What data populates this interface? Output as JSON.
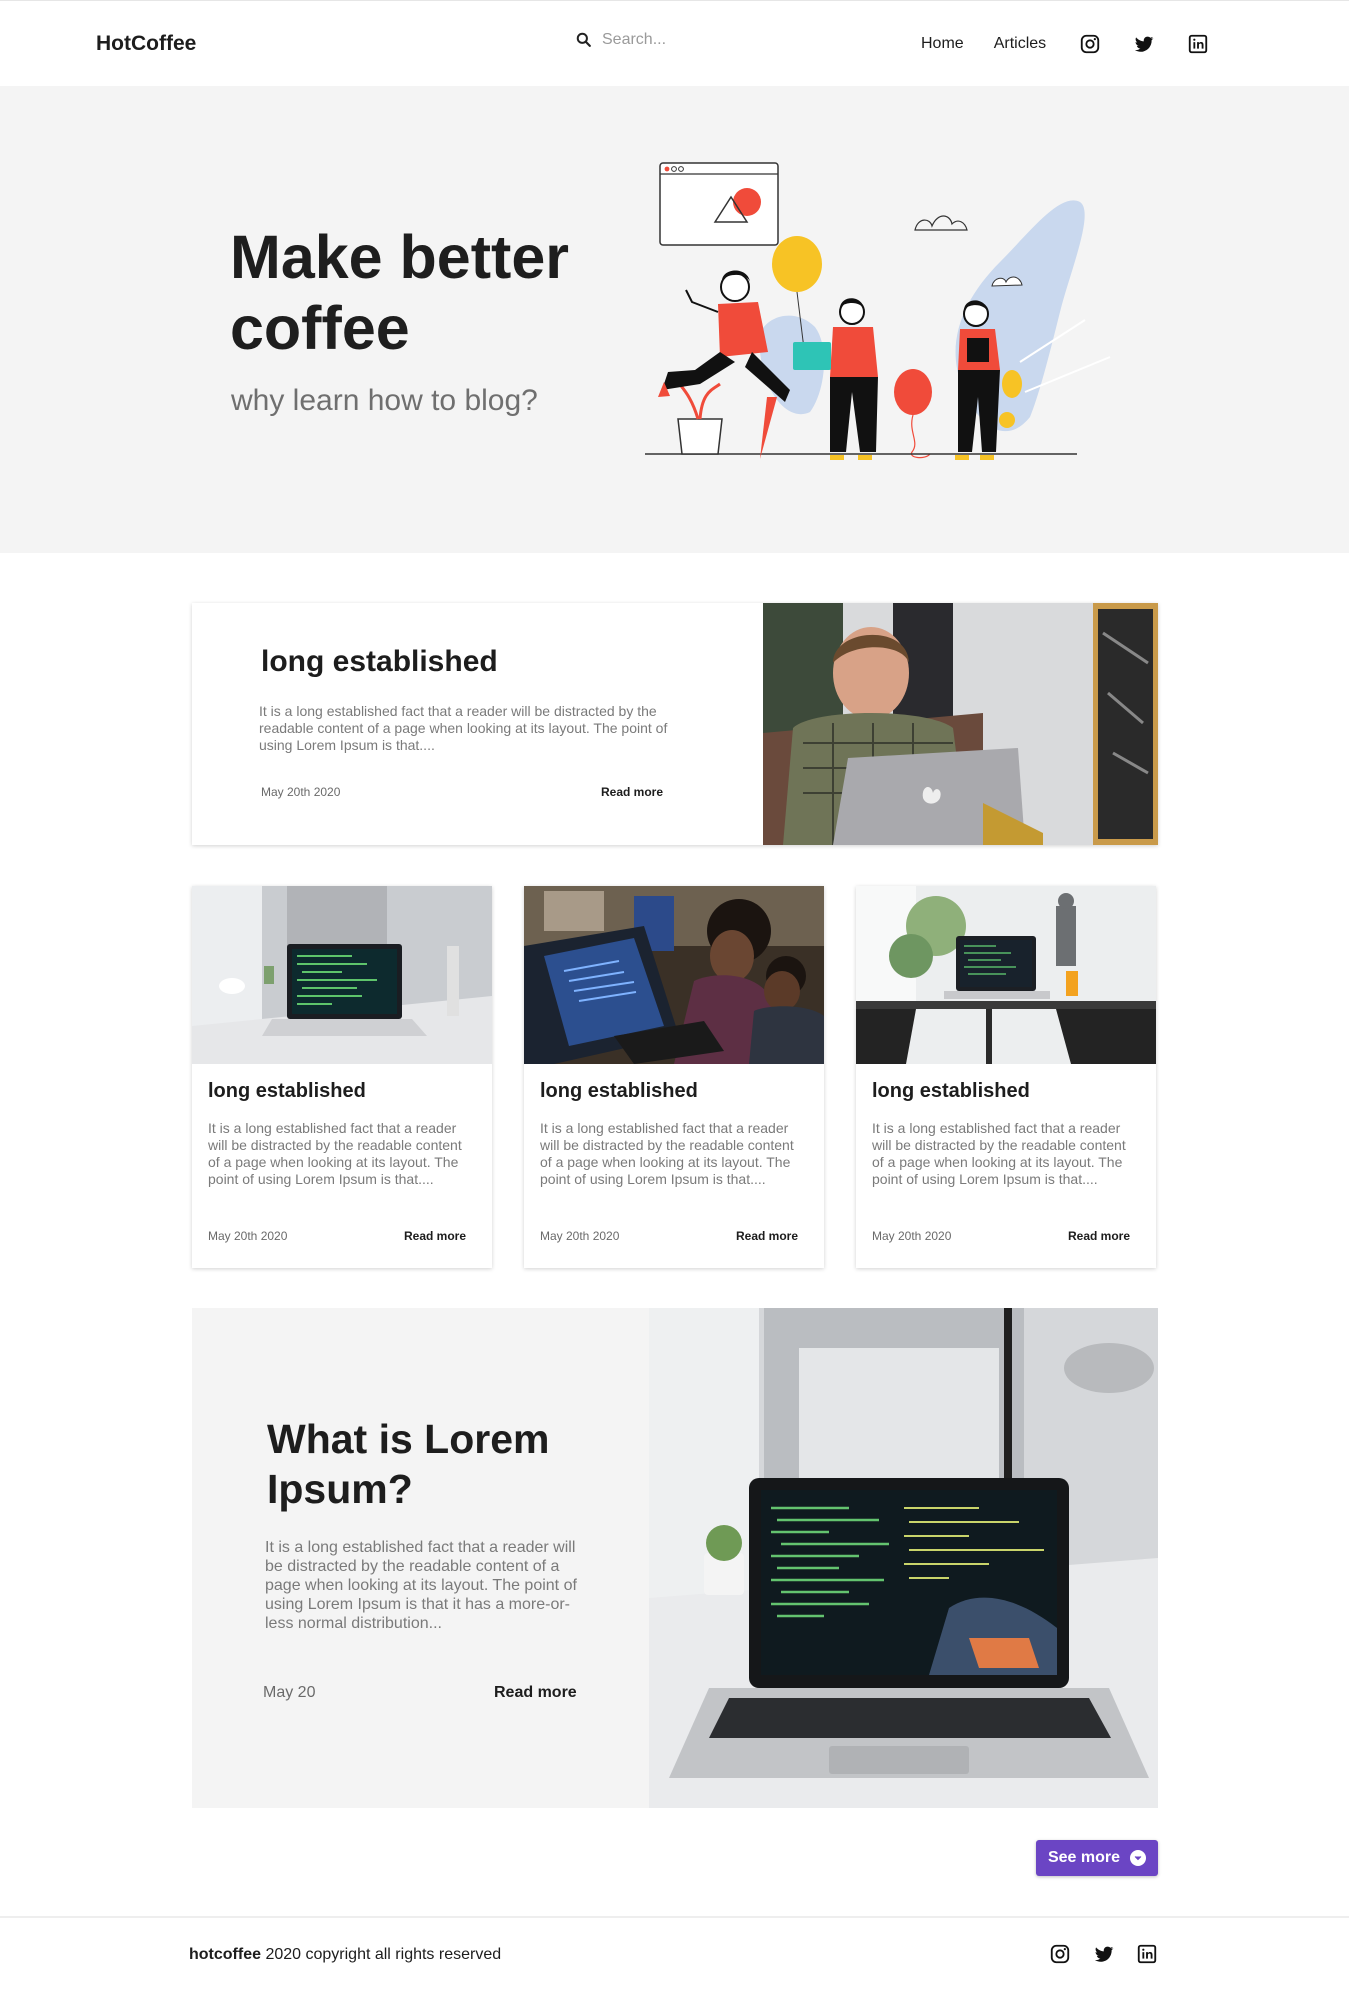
{
  "header": {
    "brand": "HotCoffee",
    "search_placeholder": "Search...",
    "nav": [
      {
        "label": "Home"
      },
      {
        "label": "Articles"
      }
    ],
    "social_icons": [
      "instagram-icon",
      "twitter-icon",
      "linkedin-icon"
    ]
  },
  "hero": {
    "title": "Make better coffee",
    "subtitle": "why learn how to blog?"
  },
  "featured": {
    "title": "long established",
    "text": "It is a long established fact that a reader will be distracted by the readable content of a page when looking at its layout. The point of using Lorem Ipsum is that....",
    "date": "May 20th 2020",
    "read_more": "Read more"
  },
  "cards": [
    {
      "title": "long established",
      "text": "It is a long established fact that a reader will be distracted by the readable content of a page when looking at its layout. The point of using Lorem Ipsum is that....",
      "date": "May 20th 2020",
      "read_more": "Read more"
    },
    {
      "title": "long established",
      "text": "It is a long established fact that a reader will be distracted by the readable content of a page when looking at its layout. The point of using Lorem Ipsum is that....",
      "date": "May 20th 2020",
      "read_more": "Read more"
    },
    {
      "title": "long established",
      "text": "It is a long established fact that a reader will be distracted by the readable content of a page when looking at its layout. The point of using Lorem Ipsum is that....",
      "date": "May 20th 2020",
      "read_more": "Read more"
    }
  ],
  "big_feature": {
    "title": "What is Lorem Ipsum?",
    "text": "It is a long established fact that a reader will be distracted by the readable content of a page when looking at its layout. The point of using Lorem Ipsum is that it has a more-or-less normal distribution...",
    "date": "May 20",
    "read_more": "Read more"
  },
  "see_more": "See more",
  "footer": {
    "brand": "hotcoffee",
    "copyright": " 2020 copyright all rights reserved"
  },
  "colors": {
    "accent": "#6b45c4",
    "hero_bg": "#f4f4f4",
    "illustration_red": "#f04b3a",
    "illustration_yellow": "#f7c325",
    "illustration_blue": "#c9d8ee"
  }
}
